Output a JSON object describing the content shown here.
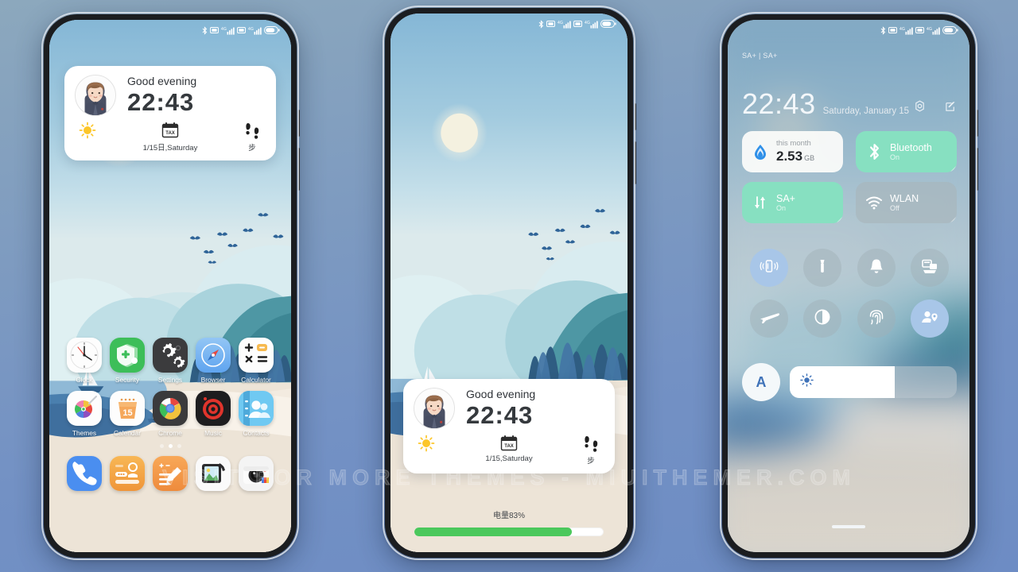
{
  "theme": {
    "accent_green": "#87e0c1",
    "accent_blue": "#a8c6e8",
    "battery_green": "#4bc85c",
    "page_bg": "#7e9bc0"
  },
  "watermark": "VISIT FOR MORE THEMES - MIUITHEMER.COM",
  "status_bar": {
    "icons": [
      "bluetooth-icon",
      "sim-icon",
      "4g-icon",
      "signal-icon",
      "sim2-icon",
      "signal2-icon",
      "battery-icon"
    ],
    "network_label": "4G"
  },
  "home_screen": {
    "widget": {
      "greeting": "Good evening",
      "time": "22:43",
      "weather_icon": "sun-icon",
      "calendar_icon": "calendar-icon",
      "calendar_label": "TAX",
      "date": "1/15日,Saturday",
      "steps_icon": "footsteps-icon",
      "steps_label": "步"
    },
    "apps_row1": [
      {
        "label": "Clock",
        "icon": "clock-icon"
      },
      {
        "label": "Security",
        "icon": "security-shield-icon"
      },
      {
        "label": "Settings",
        "icon": "settings-gear-icon"
      },
      {
        "label": "Browser",
        "icon": "browser-compass-icon"
      },
      {
        "label": "Calculator",
        "icon": "calculator-icon"
      }
    ],
    "apps_row2": [
      {
        "label": "Themes",
        "icon": "themes-pinwheel-icon"
      },
      {
        "label": "Calendar",
        "icon": "calendar-15-icon"
      },
      {
        "label": "Chrome",
        "icon": "chrome-icon"
      },
      {
        "label": "Music",
        "icon": "music-vinyl-icon"
      },
      {
        "label": "Contacts",
        "icon": "contacts-icon"
      }
    ],
    "page_dots": {
      "count": 3,
      "active_index": 1
    },
    "dock": [
      {
        "label": "Phone",
        "icon": "phone-dialer-icon"
      },
      {
        "label": "Messages",
        "icon": "messages-icon"
      },
      {
        "label": "Notes",
        "icon": "notes-pencil-icon"
      },
      {
        "label": "Gallery",
        "icon": "gallery-photo-icon"
      },
      {
        "label": "Camera",
        "icon": "camera-icon"
      }
    ]
  },
  "lock_screen": {
    "widget": {
      "greeting": "Good evening",
      "time": "22:43",
      "weather_icon": "sun-icon",
      "calendar_icon": "calendar-icon",
      "calendar_label": "TAX",
      "date": "1/15,Saturday",
      "steps_icon": "footsteps-icon",
      "steps_label": "步"
    },
    "battery": {
      "label": "电量83%",
      "percent": 83
    }
  },
  "control_center": {
    "sim_label": "SA+ | SA+",
    "time": "22:43",
    "date": "Saturday, January 15",
    "settings_icon": "gear-icon",
    "edit_icon": "edit-pencil-icon",
    "tiles": [
      {
        "name": "data-usage",
        "icon": "data-drop-icon",
        "sub": "this month",
        "value": "2.53",
        "unit": "GB",
        "style": "light"
      },
      {
        "name": "bluetooth",
        "icon": "bluetooth-icon",
        "title": "Bluetooth",
        "state": "On",
        "style": "green"
      },
      {
        "name": "mobile-data",
        "icon": "data-arrows-icon",
        "title": "SA+",
        "state": "On",
        "style": "green"
      },
      {
        "name": "wlan",
        "icon": "wifi-icon",
        "title": "WLAN",
        "state": "Off",
        "style": "gray"
      }
    ],
    "round_buttons": [
      {
        "name": "vibrate",
        "icon": "vibrate-icon",
        "on": true
      },
      {
        "name": "flashlight",
        "icon": "flashlight-icon",
        "on": false
      },
      {
        "name": "silent",
        "icon": "bell-silent-icon",
        "on": false
      },
      {
        "name": "screenshot",
        "icon": "screenshot-icon",
        "on": false
      },
      {
        "name": "airplane-mode",
        "icon": "airplane-icon",
        "on": false
      },
      {
        "name": "dark-mode",
        "icon": "contrast-circle-icon",
        "on": false
      },
      {
        "name": "fingerprint",
        "icon": "fingerprint-icon",
        "on": false
      },
      {
        "name": "location",
        "icon": "location-person-icon",
        "on": true
      }
    ],
    "auto_brightness_label": "A",
    "brightness": {
      "icon": "brightness-sun-icon",
      "percent": 63
    },
    "handle_icon": "drag-handle-icon"
  }
}
